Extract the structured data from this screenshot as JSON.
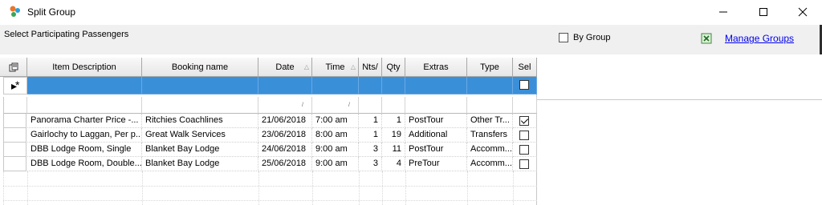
{
  "window": {
    "title": "Split Group",
    "controls": {
      "minimize": "—",
      "maximize": "☐",
      "close": "✕"
    }
  },
  "panel": {
    "select_label": "Select Participating Passengers",
    "by_group_label": "By Group",
    "by_group_checked": false,
    "manage_groups_label": "Manage Groups"
  },
  "grid": {
    "columns": [
      "Item Description",
      "Booking name",
      "Date",
      "Time",
      "Nts/",
      "Qty",
      "Extras",
      "Type",
      "Sel"
    ],
    "new_row_marker": "*",
    "rows": [
      {
        "item": "Panorama Charter Price -...",
        "booking": "Ritchies Coachlines",
        "date": "21/06/2018",
        "time": "7:00 am",
        "nts": "1",
        "qty": "1",
        "extras": "PostTour",
        "type": "Other Tr...",
        "sel": true
      },
      {
        "item": "Gairlochy to Laggan, Per p...",
        "booking": "Great Walk Services",
        "date": "23/06/2018",
        "time": "8:00 am",
        "nts": "1",
        "qty": "19",
        "extras": "Additional",
        "type": "Transfers",
        "sel": false
      },
      {
        "item": "DBB Lodge Room, Single",
        "booking": "Blanket Bay Lodge",
        "date": "24/06/2018",
        "time": "9:00 am",
        "nts": "3",
        "qty": "11",
        "extras": "PostTour",
        "type": "Accomm...",
        "sel": false
      },
      {
        "item": "DBB Lodge Room, Double...",
        "booking": "Blanket Bay Lodge",
        "date": "25/06/2018",
        "time": "9:00 am",
        "nts": "3",
        "qty": "4",
        "extras": "PreTour",
        "type": "Accomm...",
        "sel": false
      }
    ]
  }
}
